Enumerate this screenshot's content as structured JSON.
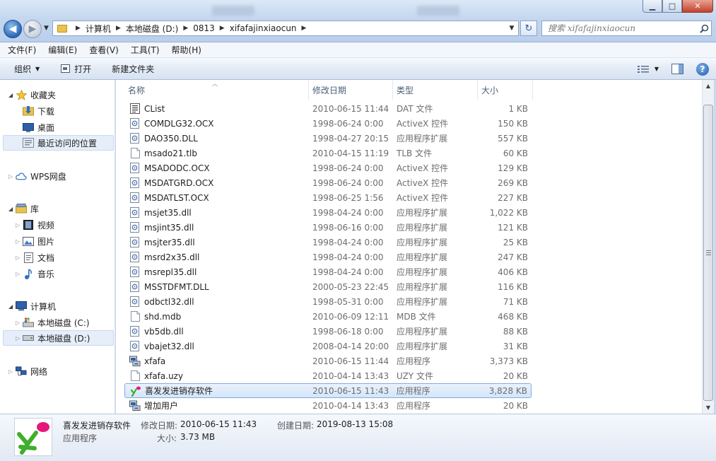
{
  "window": {
    "minimize_glyph": "▁",
    "maximize_glyph": "□",
    "close_glyph": "✕"
  },
  "navigation": {
    "back_glyph": "◀",
    "forward_glyph": "▶",
    "dropdown_glyph": "▼"
  },
  "address_bar": {
    "breadcrumbs": [
      "计算机",
      "本地磁盘 (D:)",
      "0813",
      "xifafajinxiaocun"
    ],
    "separator": "▶"
  },
  "refresh_glyph": "↻",
  "search": {
    "placeholder": "搜索 xifafajinxiaocun"
  },
  "menu": [
    "文件(F)",
    "编辑(E)",
    "查看(V)",
    "工具(T)",
    "帮助(H)"
  ],
  "toolbar": {
    "organize": "组织",
    "open": "打开",
    "new_folder": "新建文件夹",
    "help": "?"
  },
  "nav_pane": {
    "favorites": "收藏夹",
    "favorites_items": [
      "下载",
      "桌面",
      "最近访问的位置"
    ],
    "wps": "WPS网盘",
    "libraries": "库",
    "library_items": [
      "视频",
      "图片",
      "文档",
      "音乐"
    ],
    "computer": "计算机",
    "drives": [
      "本地磁盘 (C:)",
      "本地磁盘 (D:)"
    ],
    "network": "网络"
  },
  "columns": {
    "name": "名称",
    "date": "修改日期",
    "type": "类型",
    "size": "大小"
  },
  "files": [
    {
      "name": "CList",
      "date": "2010-06-15 11:44",
      "type": "DAT 文件",
      "size": "1 KB",
      "icon": "doc-lines"
    },
    {
      "name": "COMDLG32.OCX",
      "date": "1998-06-24 0:00",
      "type": "ActiveX 控件",
      "size": "150 KB",
      "icon": "dll"
    },
    {
      "name": "DAO350.DLL",
      "date": "1998-04-27 20:15",
      "type": "应用程序扩展",
      "size": "557 KB",
      "icon": "dll"
    },
    {
      "name": "msado21.tlb",
      "date": "2010-04-15 11:19",
      "type": "TLB 文件",
      "size": "60 KB",
      "icon": "blank"
    },
    {
      "name": "MSADODC.OCX",
      "date": "1998-06-24 0:00",
      "type": "ActiveX 控件",
      "size": "129 KB",
      "icon": "dll"
    },
    {
      "name": "MSDATGRD.OCX",
      "date": "1998-06-24 0:00",
      "type": "ActiveX 控件",
      "size": "269 KB",
      "icon": "dll"
    },
    {
      "name": "MSDATLST.OCX",
      "date": "1998-06-25 1:56",
      "type": "ActiveX 控件",
      "size": "227 KB",
      "icon": "dll"
    },
    {
      "name": "msjet35.dll",
      "date": "1998-04-24 0:00",
      "type": "应用程序扩展",
      "size": "1,022 KB",
      "icon": "dll"
    },
    {
      "name": "msjint35.dll",
      "date": "1998-06-16 0:00",
      "type": "应用程序扩展",
      "size": "121 KB",
      "icon": "dll"
    },
    {
      "name": "msjter35.dll",
      "date": "1998-04-24 0:00",
      "type": "应用程序扩展",
      "size": "25 KB",
      "icon": "dll"
    },
    {
      "name": "msrd2x35.dll",
      "date": "1998-04-24 0:00",
      "type": "应用程序扩展",
      "size": "247 KB",
      "icon": "dll"
    },
    {
      "name": "msrepl35.dll",
      "date": "1998-04-24 0:00",
      "type": "应用程序扩展",
      "size": "406 KB",
      "icon": "dll"
    },
    {
      "name": "MSSTDFMT.DLL",
      "date": "2000-05-23 22:45",
      "type": "应用程序扩展",
      "size": "116 KB",
      "icon": "dll"
    },
    {
      "name": "odbctl32.dll",
      "date": "1998-05-31 0:00",
      "type": "应用程序扩展",
      "size": "71 KB",
      "icon": "dll"
    },
    {
      "name": "shd.mdb",
      "date": "2010-06-09 12:11",
      "type": "MDB 文件",
      "size": "468 KB",
      "icon": "blank"
    },
    {
      "name": "vb5db.dll",
      "date": "1998-06-18 0:00",
      "type": "应用程序扩展",
      "size": "88 KB",
      "icon": "dll"
    },
    {
      "name": "vbajet32.dll",
      "date": "2008-04-14 20:00",
      "type": "应用程序扩展",
      "size": "31 KB",
      "icon": "dll"
    },
    {
      "name": "xfafa",
      "date": "2010-06-15 11:44",
      "type": "应用程序",
      "size": "3,373 KB",
      "icon": "app"
    },
    {
      "name": "xfafa.uzy",
      "date": "2010-04-14 13:43",
      "type": "UZY 文件",
      "size": "20 KB",
      "icon": "blank"
    },
    {
      "name": "喜发发进销存软件",
      "date": "2010-06-15 11:43",
      "type": "应用程序",
      "size": "3,828 KB",
      "icon": "xfafa-logo",
      "selected": true
    },
    {
      "name": "增加用户",
      "date": "2010-04-14 13:43",
      "type": "应用程序",
      "size": "20 KB",
      "icon": "app"
    }
  ],
  "details": {
    "name": "喜发发进销存软件",
    "kind": "应用程序",
    "modified_label": "修改日期:",
    "modified": "2010-06-15 11:43",
    "created_label": "创建日期:",
    "created": "2019-08-13 15:08",
    "size_label": "大小:",
    "size": "3.73 MB"
  },
  "colors": {
    "selection_bg": "#d4e6fa",
    "selection_border": "#84acdd",
    "logo_green": "#3fae2a",
    "logo_pink": "#e5197a"
  }
}
